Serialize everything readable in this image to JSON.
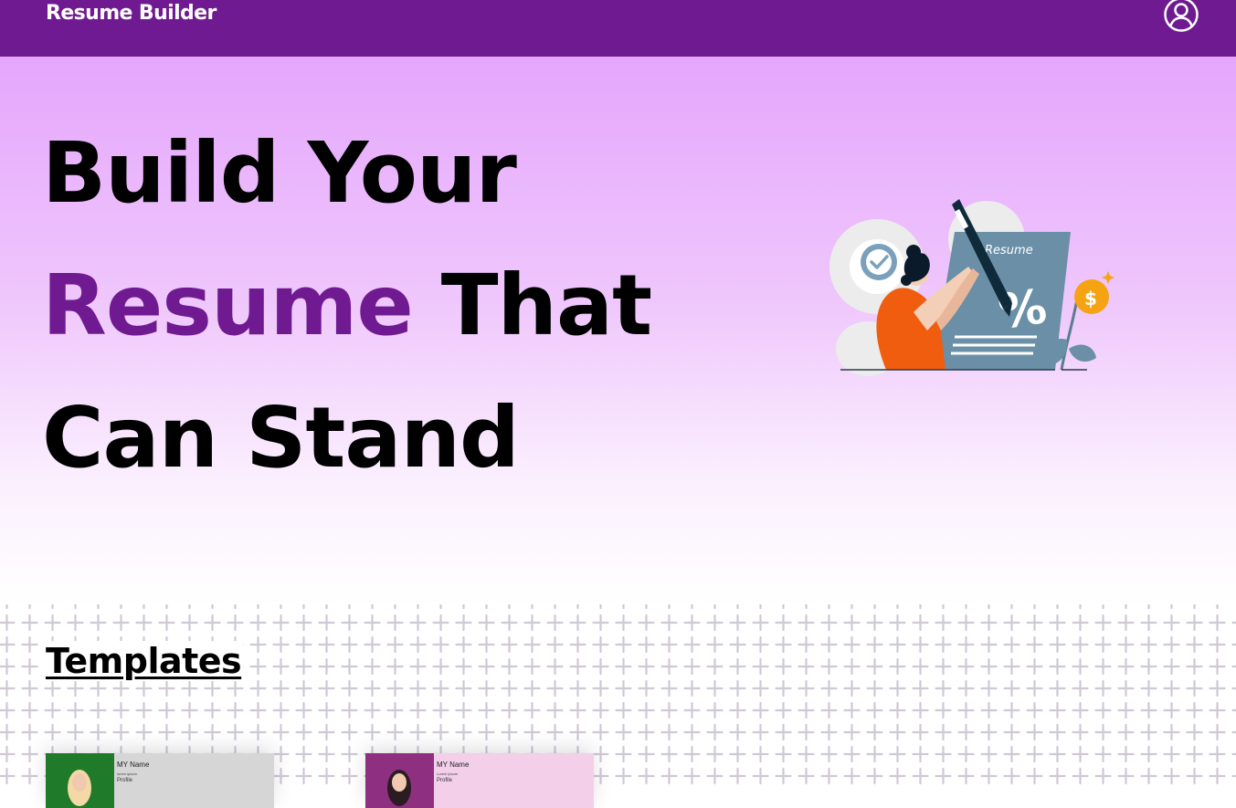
{
  "app": {
    "brand": "Resume Builder"
  },
  "hero": {
    "line1": "Build Your",
    "line2_accent": "Resume",
    "line2_rest": " That",
    "line3": "Can Stand",
    "illustration_label": "Resume"
  },
  "templates": {
    "title": "Templates",
    "cards": [
      {
        "name": "MY Name",
        "subtitle": "lorem ipsum",
        "section": "Profile"
      },
      {
        "name": "MY Name",
        "subtitle": "Lorem ipsum",
        "section": "Profile"
      }
    ]
  },
  "icons": {
    "profile": "user-circle-icon",
    "zoom": "zoom-in-icon",
    "check": "check-icon",
    "dollar": "dollar-icon"
  },
  "colors": {
    "primary": "#701a91",
    "hero_gradient_top": "#e5a6fc",
    "orange": "#f05d0e",
    "slate": "#6a8fa6",
    "gold": "#f6a313"
  }
}
